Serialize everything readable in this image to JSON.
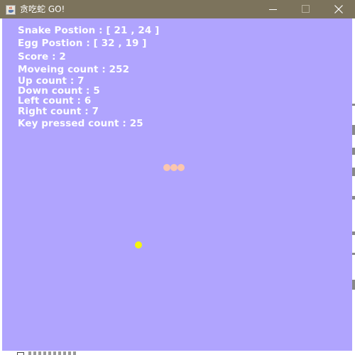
{
  "window": {
    "title": "贪吃蛇 GO!",
    "titlebar_color": "#7c735c",
    "controls": {
      "minimize_icon": "minimize-icon",
      "maximize_icon": "maximize-icon",
      "close_icon": "close-icon"
    }
  },
  "game": {
    "background_color": "#b0a4fe",
    "snake_color": "#fbc6ae",
    "egg_color": "#f5f50c",
    "hud": {
      "snake_position": "Snake Postion : [ 21 , 24 ]",
      "egg_position": "Egg Postion : [ 32 , 19 ]",
      "score": "Score : 2",
      "moving_count": "Moveing count : 252",
      "up_count": "Up count : 7",
      "down_count": "Down count : 5",
      "left_count": "Left count : 6",
      "right_count": "Right count : 7",
      "key_pressed_count": "Key pressed count : 25"
    }
  }
}
